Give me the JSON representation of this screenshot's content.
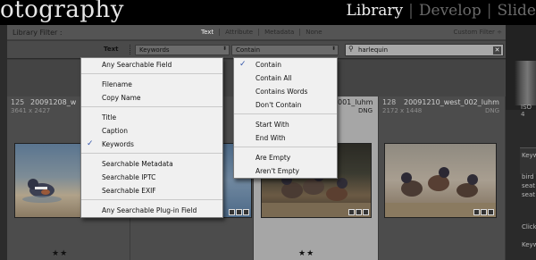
{
  "app": {
    "brand_partial": "otography",
    "modules": [
      "Library",
      "Develop",
      "Slide"
    ],
    "active_module": "Library"
  },
  "filter_bar": {
    "title": "Library Filter :",
    "tabs": [
      "Text",
      "Attribute",
      "Metadata",
      "None"
    ],
    "active_tab": "Text",
    "custom_filter": "Custom Filter ÷"
  },
  "search_row": {
    "label": "Text",
    "field_select": "Keywords",
    "rule_select": "Contain",
    "query": "harlequin",
    "clear_icon": "clear-x-icon",
    "search_icon": "magnifier-icon"
  },
  "field_menu": {
    "groups": [
      [
        {
          "label": "Any Searchable Field",
          "checked": false
        }
      ],
      [
        {
          "label": "Filename",
          "checked": false
        },
        {
          "label": "Copy Name",
          "checked": false
        }
      ],
      [
        {
          "label": "Title",
          "checked": false
        },
        {
          "label": "Caption",
          "checked": false
        },
        {
          "label": "Keywords",
          "checked": true
        }
      ],
      [
        {
          "label": "Searchable Metadata",
          "checked": false
        },
        {
          "label": "Searchable IPTC",
          "checked": false
        },
        {
          "label": "Searchable EXIF",
          "checked": false
        }
      ],
      [
        {
          "label": "Any Searchable Plug-in Field",
          "checked": false
        }
      ]
    ]
  },
  "rule_menu": {
    "groups": [
      [
        {
          "label": "Contain",
          "checked": true
        },
        {
          "label": "Contain All",
          "checked": false
        },
        {
          "label": "Contains Words",
          "checked": false
        },
        {
          "label": "Don't Contain",
          "checked": false
        }
      ],
      [
        {
          "label": "Start With",
          "checked": false
        },
        {
          "label": "End With",
          "checked": false
        }
      ],
      [
        {
          "label": "Are Empty",
          "checked": false
        },
        {
          "label": "Aren't Empty",
          "checked": false
        }
      ]
    ]
  },
  "grid": {
    "cells": [
      {
        "num": "125",
        "filename": "20091208_w",
        "dims": "3641 x 2427",
        "format": "",
        "stars": "★★",
        "selected": false
      },
      {
        "num": "",
        "filename": "",
        "dims": "",
        "format": "",
        "stars": "",
        "selected": false
      },
      {
        "num": "",
        "filename": "001_luhm",
        "dims": "",
        "format": "DNG",
        "stars": "★★",
        "selected": true
      },
      {
        "num": "128",
        "filename": "20091210_west_002_luhm",
        "dims": "2172 x 1448",
        "format": "DNG",
        "stars": "",
        "selected": false
      }
    ]
  },
  "right_panel": {
    "iso": "ISO 4",
    "labels": [
      "Keyw",
      "bird",
      "seat",
      "seat",
      "Click",
      "Keyw"
    ]
  },
  "colors": {
    "menu_bg": "#f0f0f0",
    "checkmark": "#3355aa",
    "active_tab": "#f2f2f2",
    "selected_cell": "#a6a6a6"
  }
}
